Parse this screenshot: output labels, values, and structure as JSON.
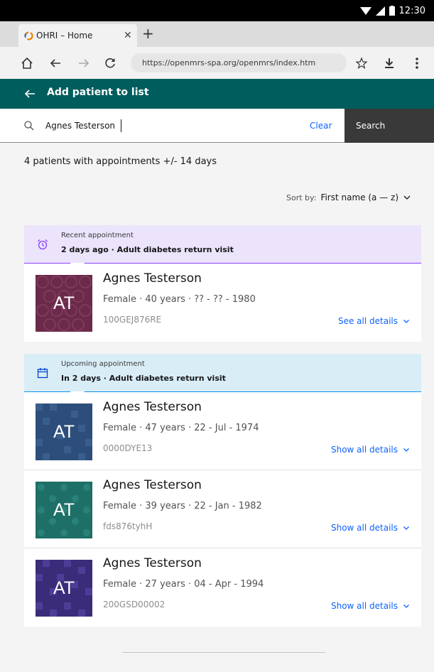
{
  "status_bar": {
    "time": "12:30"
  },
  "browser": {
    "tab_title": "OHRI – Home",
    "url": "https://openmrs-spa.org/openmrs/index.htm"
  },
  "header": {
    "title": "Add patient to list"
  },
  "search": {
    "value": "Agnes Testerson",
    "clear_label": "Clear",
    "search_label": "Search"
  },
  "results": {
    "count_text": "4 patients with appointments +/- 14 days",
    "sort_label": "Sort by:",
    "sort_value": "First name (a — z)"
  },
  "groups": [
    {
      "label": "Recent appointment",
      "detail": "2 days ago · Adult diabetes return visit",
      "accent": "#8a3ffc"
    },
    {
      "label": "Upcoming appointment",
      "detail": "In 2 days · Adult diabetes return visit",
      "accent": "#1192e8"
    }
  ],
  "patients": [
    {
      "initials": "AT",
      "name": "Agnes Testerson",
      "demographics": "Female · 40 years · ?? - ?? - 1980",
      "id": "100GEJ876RE",
      "details_label": "See all details",
      "avatar_color": "#6b2a4a"
    },
    {
      "initials": "AT",
      "name": "Agnes Testerson",
      "demographics": "Female · 47 years · 22 - Jul - 1974",
      "id": "0000DYE13",
      "details_label": "Show all details",
      "avatar_color": "#2d4e7a"
    },
    {
      "initials": "AT",
      "name": "Agnes Testerson",
      "demographics": "Female · 39 years · 22 - Jan - 1982",
      "id": "fds876tyhH",
      "details_label": "Show all details",
      "avatar_color": "#1d6f67"
    },
    {
      "initials": "AT",
      "name": "Agnes Testerson",
      "demographics": "Female · 27 years · 04 - Apr - 1994",
      "id": "200GSD00002",
      "details_label": "Show all details",
      "avatar_color": "#3b2c7a"
    }
  ]
}
